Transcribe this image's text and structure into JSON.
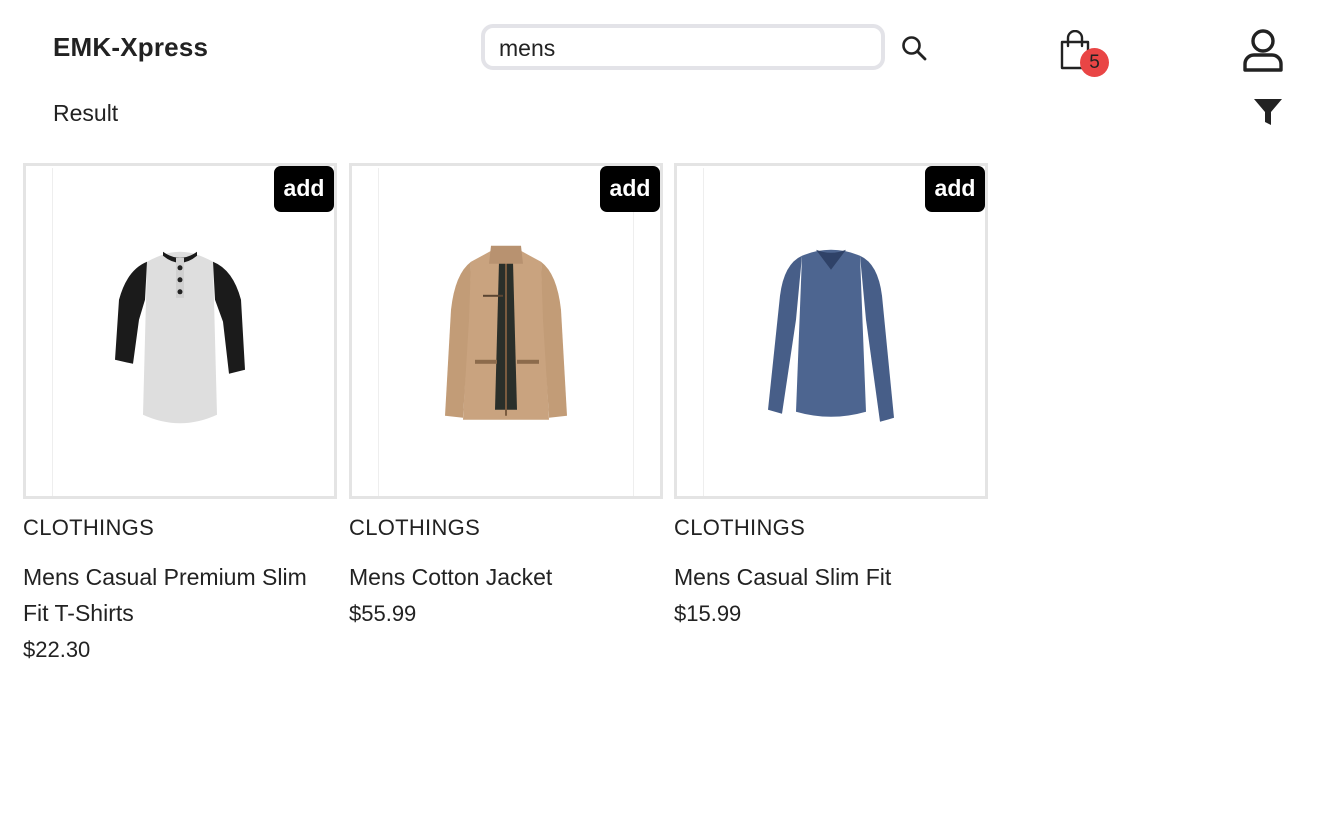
{
  "header": {
    "logo": "EMK-Xpress",
    "search": {
      "value": "mens",
      "placeholder": ""
    },
    "cart_count": "5"
  },
  "page": {
    "result_label": "Result"
  },
  "products": [
    {
      "category": "CLOTHINGS",
      "title": "Mens Casual Premium Slim Fit T-Shirts",
      "price": "$22.30",
      "add_label": "add",
      "image_icon": "raglan-henley-shirt"
    },
    {
      "category": "CLOTHINGS",
      "title": "Mens Cotton Jacket",
      "price": "$55.99",
      "add_label": "add",
      "image_icon": "khaki-jacket"
    },
    {
      "category": "CLOTHINGS",
      "title": "Mens Casual Slim Fit",
      "price": "$15.99",
      "add_label": "add",
      "image_icon": "blue-long-sleeve-tee"
    }
  ],
  "colors": {
    "accent_badge": "#e94545",
    "add_button": "#000000",
    "card_border": "#e4e4e4"
  }
}
